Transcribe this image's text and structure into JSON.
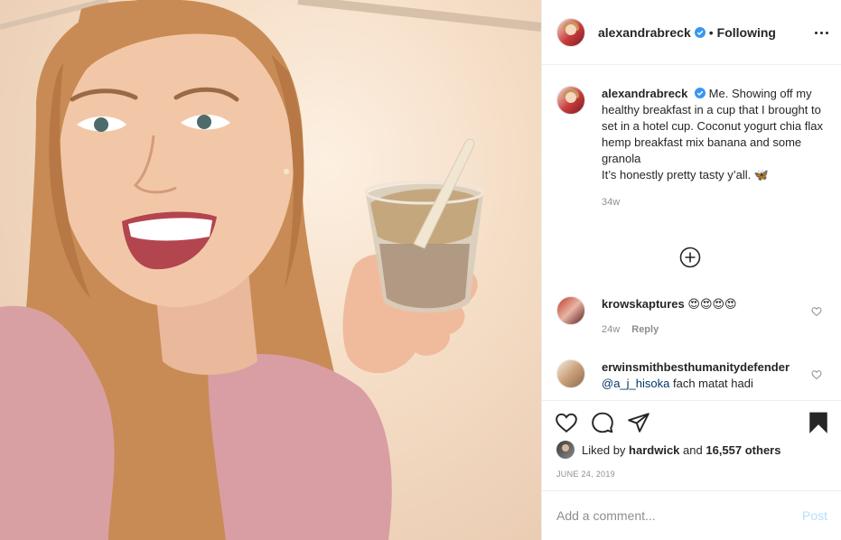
{
  "post": {
    "author": "alexandrabreck",
    "follow_status": "Following",
    "separator": "•",
    "caption": "Me. Showing off my healthy breakfast in a cup that I brought to set in a hotel cup. Coconut yogurt chia flax hemp breakfast mix banana and some granola\nIt’s honestly pretty tasty y’all. 🦋",
    "caption_time": "34w",
    "date": "June 24, 2019"
  },
  "comments": [
    {
      "user": "krowskaptures",
      "text": "😍😍😍😍",
      "time": "24w",
      "reply_label": "Reply"
    },
    {
      "user": "erwinsmithbesthumanitydefender",
      "mention": "@a_j_hisoka",
      "text": " fach matat hadi"
    }
  ],
  "likes": {
    "prefix": "Liked by",
    "user": "hardwick",
    "conjunction": "and",
    "others": "16,557 others"
  },
  "add_comment": {
    "placeholder": "Add a comment...",
    "post_label": "Post"
  },
  "icons": {
    "verified": "verified-badge-icon",
    "more": "more-options-icon",
    "load_more": "plus-circle-icon",
    "like": "heart-icon",
    "comment": "comment-bubble-icon",
    "share": "paper-plane-icon",
    "save": "bookmark-filled-icon"
  },
  "colors": {
    "verified_blue": "#3897f0",
    "text": "#262626",
    "secondary": "#8e8e8e",
    "link": "#00376b",
    "post_disabled": "#b2dffc"
  }
}
